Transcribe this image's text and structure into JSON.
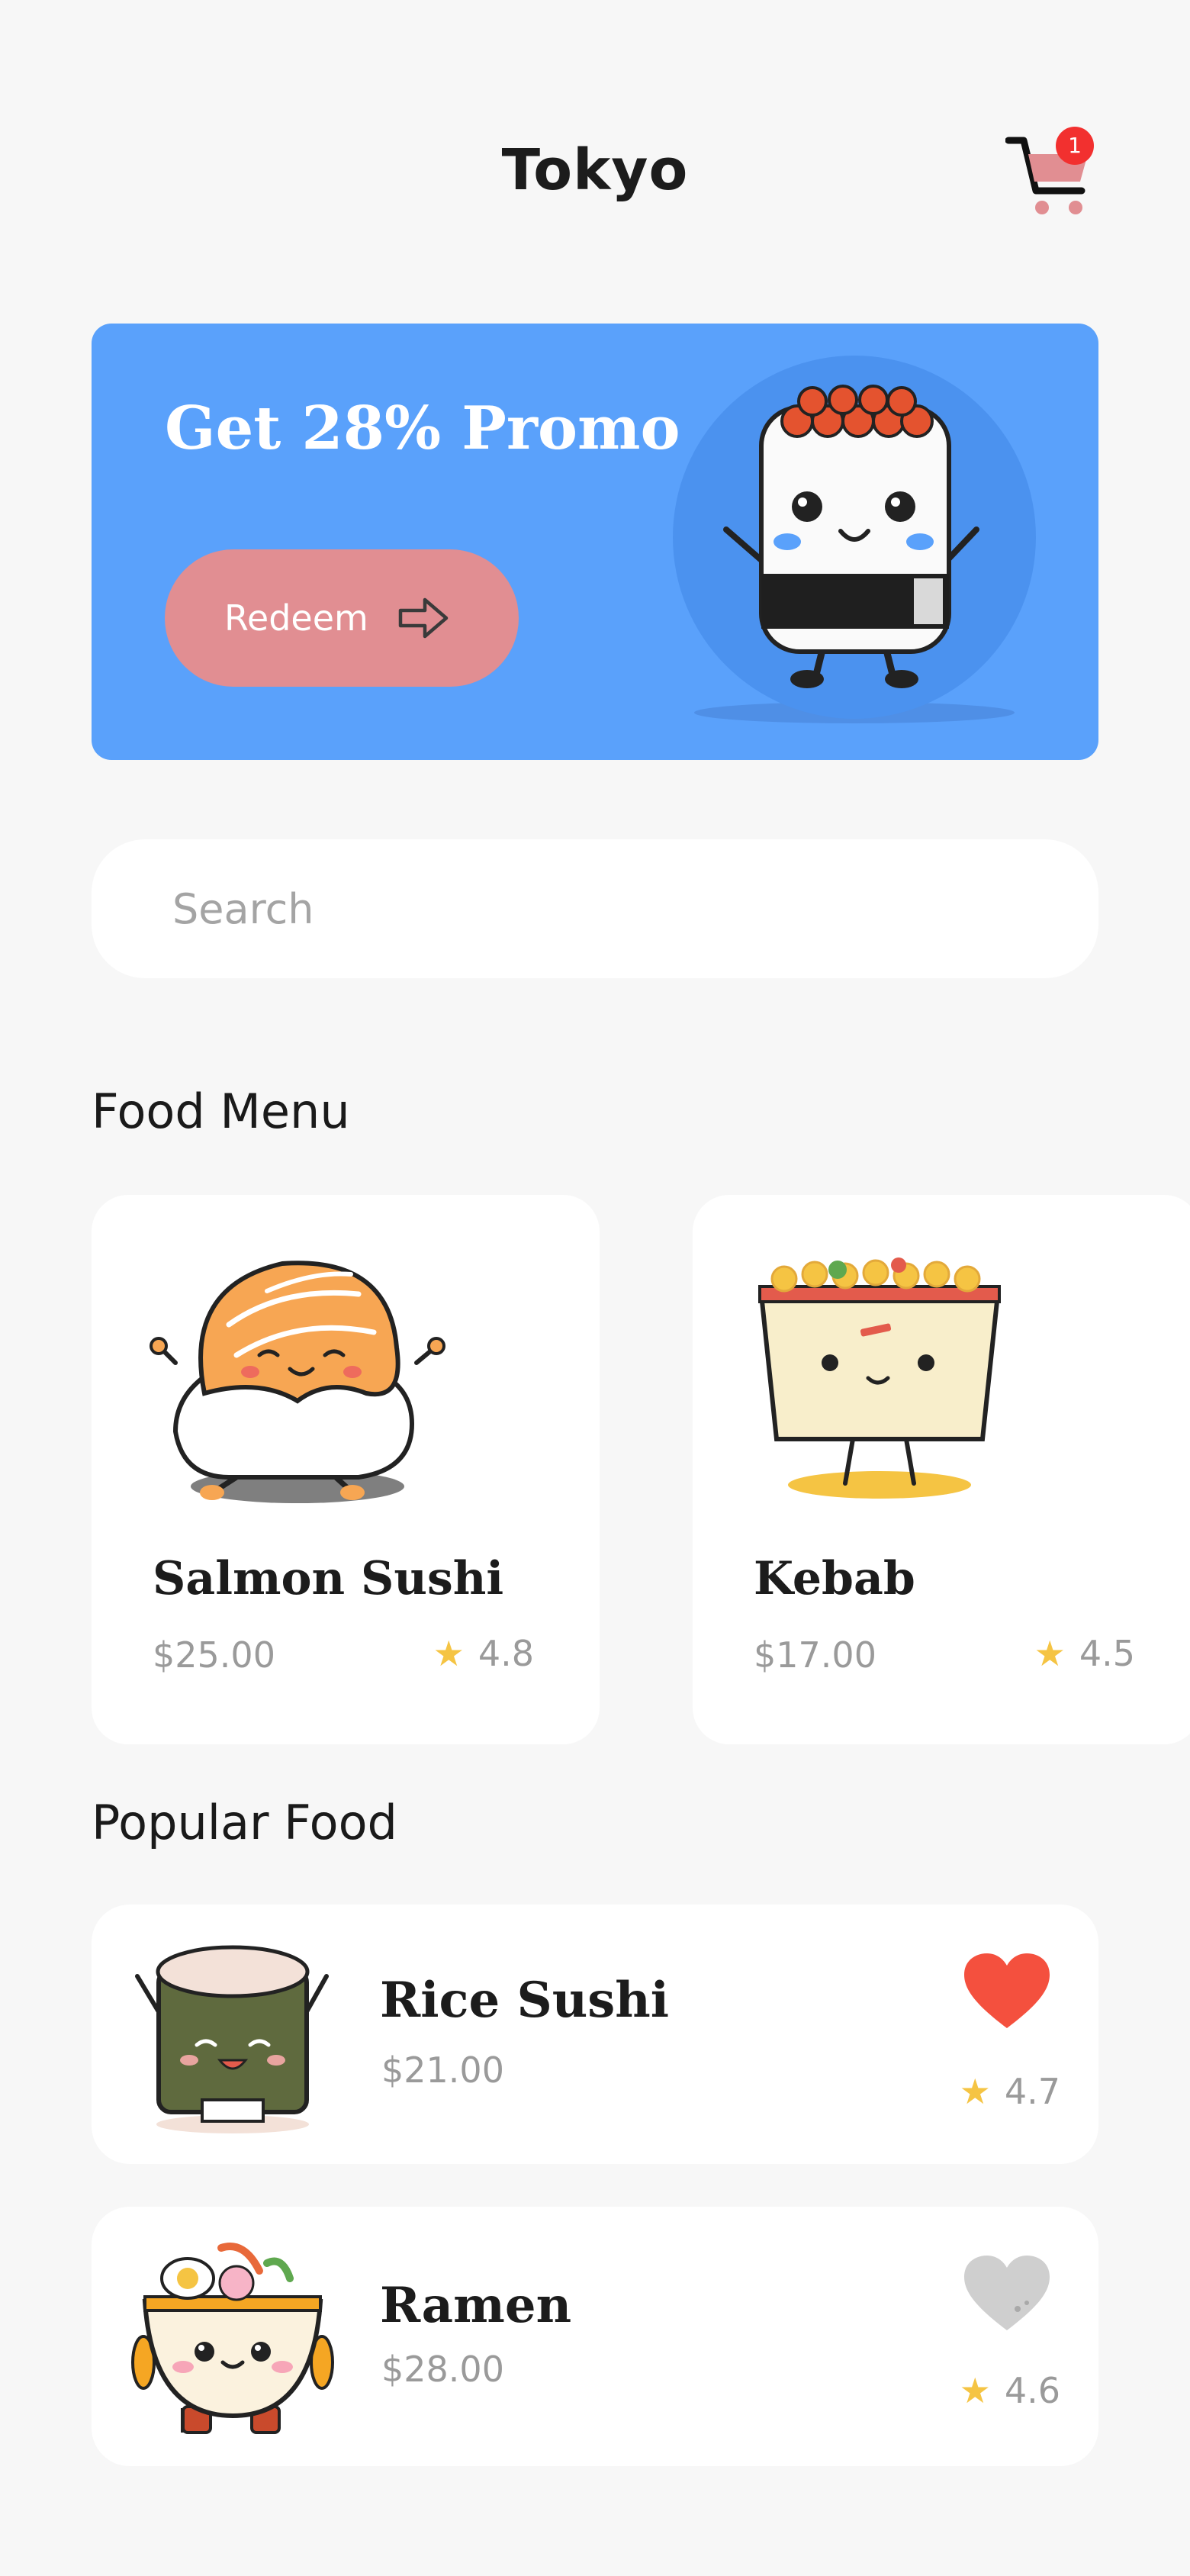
{
  "header": {
    "title": "Tokyo",
    "cart_count": "1"
  },
  "promo": {
    "title": "Get 28% Promo",
    "button_label": "Redeem"
  },
  "search": {
    "placeholder": "Search",
    "value": ""
  },
  "food_menu": {
    "heading": "Food Menu",
    "items": [
      {
        "name": "Salmon Sushi",
        "price": "$25.00",
        "rating": "4.8",
        "icon": "salmon-sushi-illustration"
      },
      {
        "name": "Kebab",
        "price": "$17.00",
        "rating": "4.5",
        "icon": "kebab-illustration"
      }
    ]
  },
  "popular_food": {
    "heading": "Popular Food",
    "items": [
      {
        "name": "Rice Sushi",
        "price": "$21.00",
        "rating": "4.7",
        "favorite": true,
        "icon": "rice-sushi-illustration"
      },
      {
        "name": "Ramen",
        "price": "$28.00",
        "rating": "4.6",
        "favorite": false,
        "icon": "ramen-illustration"
      }
    ]
  },
  "colors": {
    "background": "#f7f7f7",
    "promo_blue": "#5aa1fb",
    "redeem_pink": "#e18e92",
    "badge_red": "#f2302f",
    "star_yellow": "#f5c443",
    "heart_active": "#f4503e",
    "heart_inactive": "#cfcfcf"
  }
}
